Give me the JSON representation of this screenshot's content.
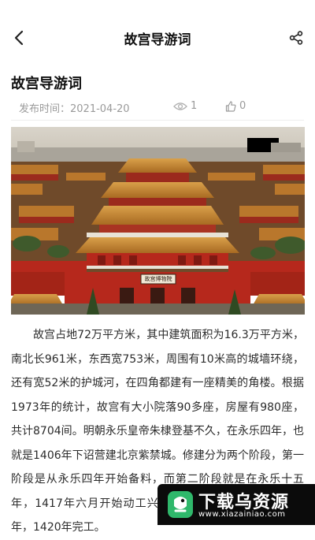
{
  "header": {
    "title": "故宫导游词"
  },
  "article": {
    "title": "故宫导游词",
    "date_label": "发布时间：",
    "date": "2021-04-20",
    "views": "1",
    "likes": "0",
    "image_sign": "故宫博物院",
    "body": "故宫占地72万平方米，其中建筑面积为16.3万平方米，南北长961米，东西宽753米，周围有10米高的城墙环绕，还有宽52米的护城河，在四角都建有一座精美的角楼。根据1973年的统计，故宫有大小院落90多座，房屋有980座，共计8704间。明朝永乐皇帝朱棣登基不久，在永乐四年，也就是1406年下诏营建北京紫禁城。修建分为两个阶段，第一阶段是从永乐四年开始备料，而第二阶段就是在永乐十五年，1417年六月开始动工兴建，历时14年，在永乐十八年，1420年完工。"
  },
  "watermark": {
    "title": "下载乌资源",
    "url": "www.xiazainiao.com"
  },
  "colors": {
    "wall_red": "#b6281c",
    "roof_gold": "#c98a2c",
    "sky": "#dcd7cc"
  }
}
